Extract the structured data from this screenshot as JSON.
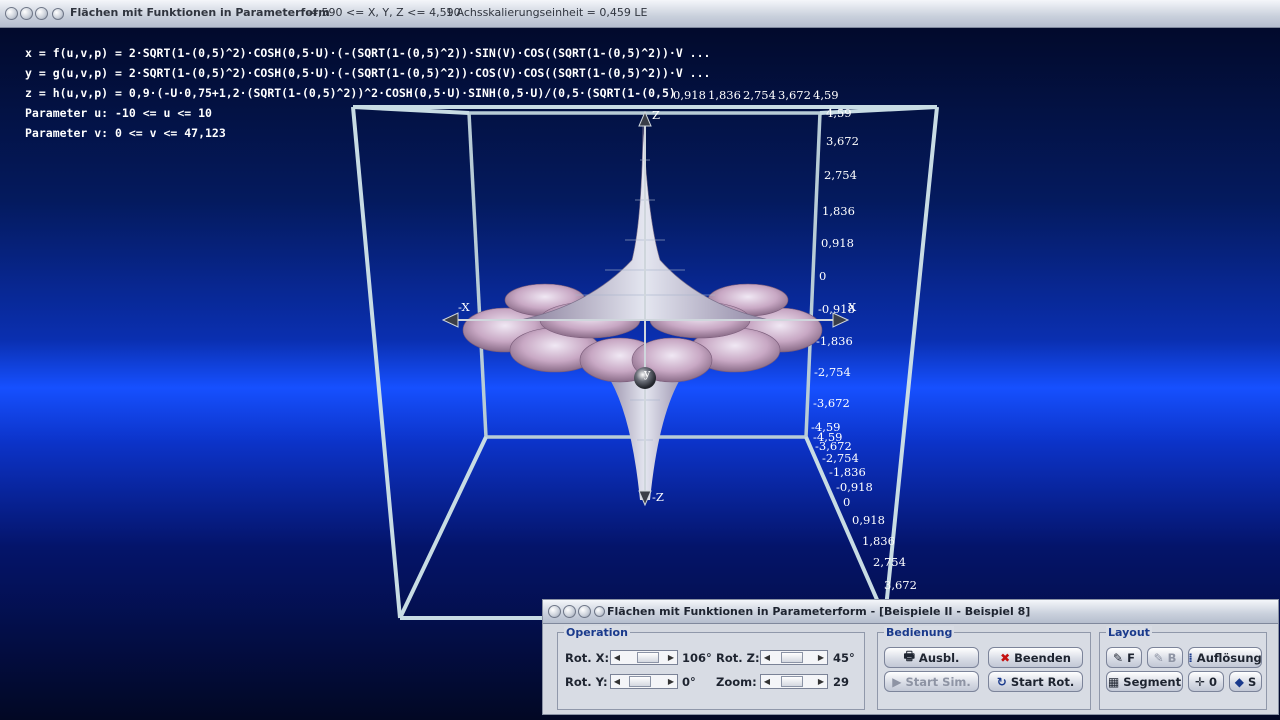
{
  "window": {
    "title": "Flächen mit Funktionen in Parameterform",
    "range": "-4,590 <= X, Y, Z <= 4,590",
    "scale": "1 Achsskalierungseinheit = 0,459 LE"
  },
  "equations": {
    "x": "x = f(u,v,p) = 2·SQRT(1-(0,5)^2)·COSH(0,5·U)·(-(SQRT(1-(0,5)^2))·SIN(V)·COS((SQRT(1-(0,5)^2))·V ...",
    "y": "y = g(u,v,p) = 2·SQRT(1-(0,5)^2)·COSH(0,5·U)·(-(SQRT(1-(0,5)^2))·COS(V)·COS((SQRT(1-(0,5)^2))·V ...",
    "z": "z = h(u,v,p) = 0,9·(-U·0,75+1,2·(SQRT(1-(0,5)^2))^2·COSH(0,5·U)·SINH(0,5·U)/(0,5·(SQRT(1-(0,5)",
    "param_u": "Parameter u: -10 <= u <= 10",
    "param_v": "Parameter v: 0 <= v <= 47,123"
  },
  "axes": {
    "x_pos": "X",
    "x_neg": "-X",
    "y_label": "y",
    "z_pos": "Z",
    "z_neg": "-Z",
    "z_ticks": [
      "4,59",
      "3,672",
      "2,754",
      "1,836",
      "0,918",
      "0",
      "-0,918",
      "-1,836",
      "-2,754",
      "-3,672",
      "-4,59"
    ],
    "top_ticks": [
      "0,918",
      "1,836",
      "2,754",
      "3,672",
      "4,59"
    ],
    "y_ticks": [
      "-4,59",
      "-3,672",
      "-2,754",
      "-1,836",
      "-0,918",
      "0",
      "0,918",
      "1,836",
      "2,754",
      "3,672"
    ]
  },
  "panel": {
    "title": "Flächen mit Funktionen in Parameterform - [Beispiele II - Beispiel 8]",
    "operation": {
      "title": "Operation",
      "rot_x_label": "Rot. X:",
      "rot_x_value": "106°",
      "rot_y_label": "Rot. Y:",
      "rot_y_value": "0°",
      "rot_z_label": "Rot. Z:",
      "rot_z_value": "45°",
      "zoom_label": "Zoom:",
      "zoom_value": "29"
    },
    "bedienung": {
      "title": "Bedienung",
      "ausbl": "Ausbl.",
      "beenden": "Beenden",
      "start_sim": "Start Sim.",
      "start_rot": "Start Rot."
    },
    "layout": {
      "title": "Layout",
      "f": "F",
      "b": "B",
      "aufloesung": "Auflösung",
      "segment": "Segment",
      "zero": "0",
      "s": "S"
    }
  },
  "colors": {
    "accent": "#1a3a8c",
    "background_glow": "#1650ff",
    "frame": "#c8dce4"
  }
}
